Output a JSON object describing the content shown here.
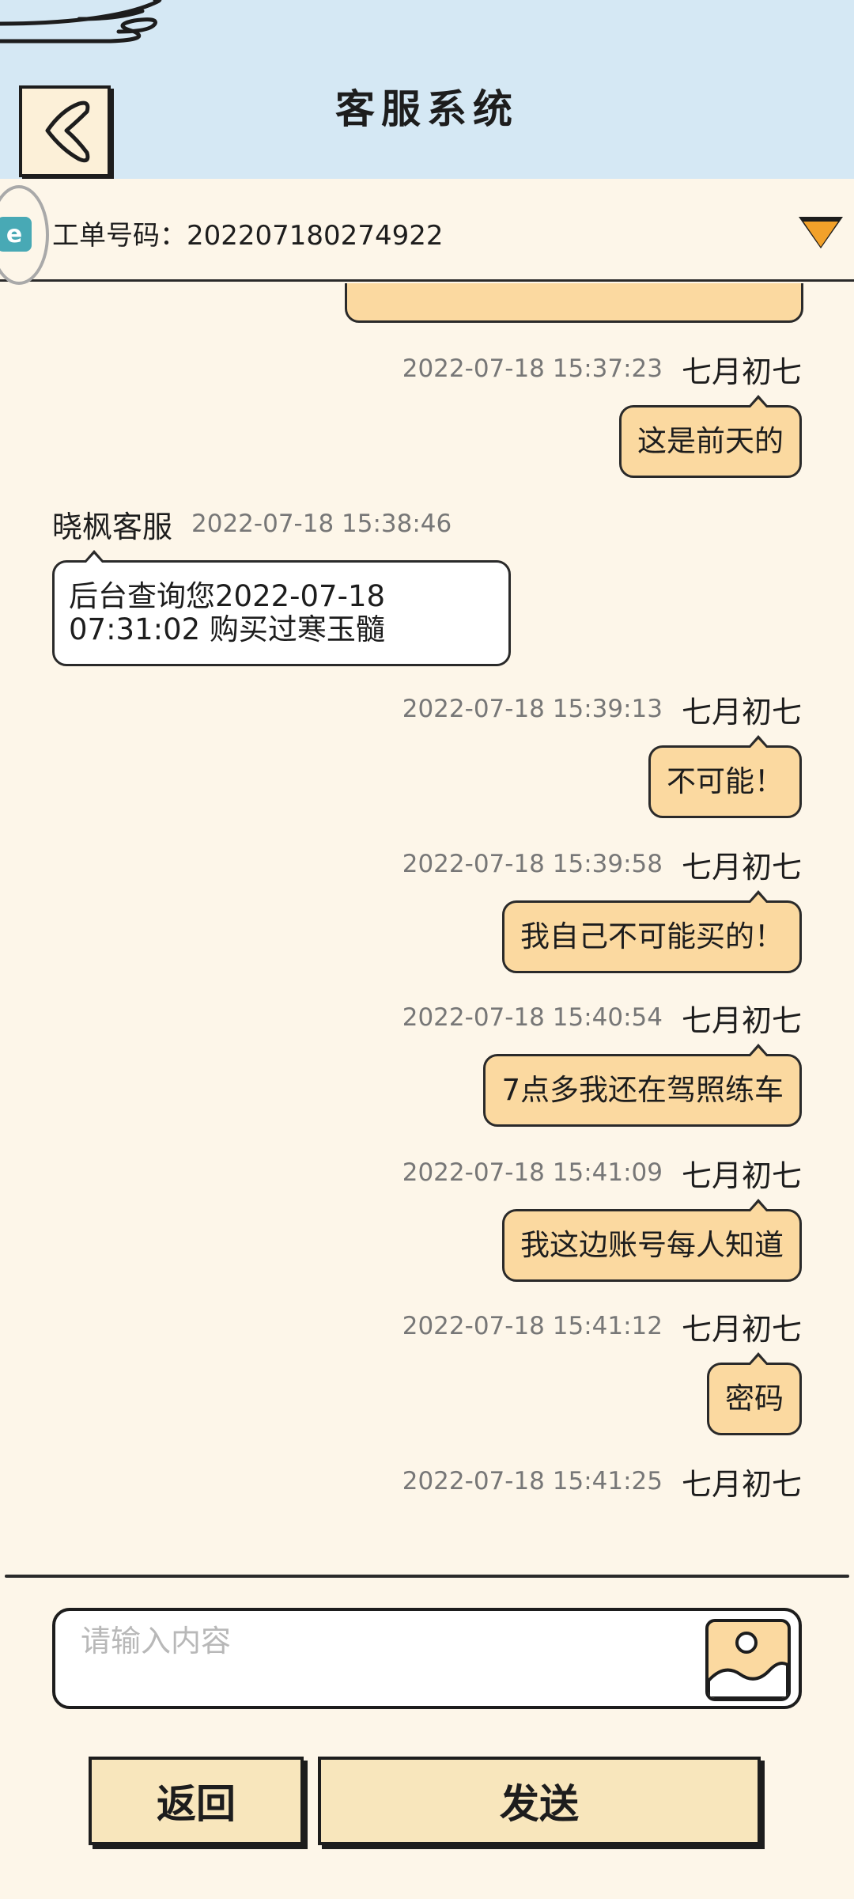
{
  "header": {
    "title": "客服系统"
  },
  "ticket": {
    "label": "工单号码：202207180274922",
    "logo_text": "e"
  },
  "messages": [
    {
      "side": "right",
      "sender": "七月初七",
      "time": "2022-07-18 15:37:23",
      "text": "这是前天的"
    },
    {
      "side": "left",
      "sender": "晓枫客服",
      "time": "2022-07-18 15:38:46",
      "text": "后台查询您2022-07-18 07:31:02 购买过寒玉髓"
    },
    {
      "side": "right",
      "sender": "七月初七",
      "time": "2022-07-18 15:39:13",
      "text": "不可能！"
    },
    {
      "side": "right",
      "sender": "七月初七",
      "time": "2022-07-18 15:39:58",
      "text": "我自己不可能买的！"
    },
    {
      "side": "right",
      "sender": "七月初七",
      "time": "2022-07-18 15:40:54",
      "text": "7点多我还在驾照练车"
    },
    {
      "side": "right",
      "sender": "七月初七",
      "time": "2022-07-18 15:41:09",
      "text": "我这边账号每人知道"
    },
    {
      "side": "right",
      "sender": "七月初七",
      "time": "2022-07-18 15:41:12",
      "text": "密码"
    },
    {
      "side": "right",
      "sender": "七月初七",
      "time": "2022-07-18 15:41:25",
      "text": ""
    }
  ],
  "composer": {
    "placeholder": "请输入内容",
    "value": ""
  },
  "buttons": {
    "back_label": "返回",
    "send_label": "发送"
  },
  "colors": {
    "header_bg": "#d5e8f4",
    "page_bg": "#fdf6e9",
    "outgoing_bubble": "#fbd9a0",
    "incoming_bubble": "#ffffff",
    "button_bg": "#f8e6bc",
    "accent_arrow": "#f2a12a"
  },
  "icons": {
    "back": "back-chevron-icon",
    "dropdown": "dropdown-triangle-icon",
    "image": "image-upload-icon"
  }
}
